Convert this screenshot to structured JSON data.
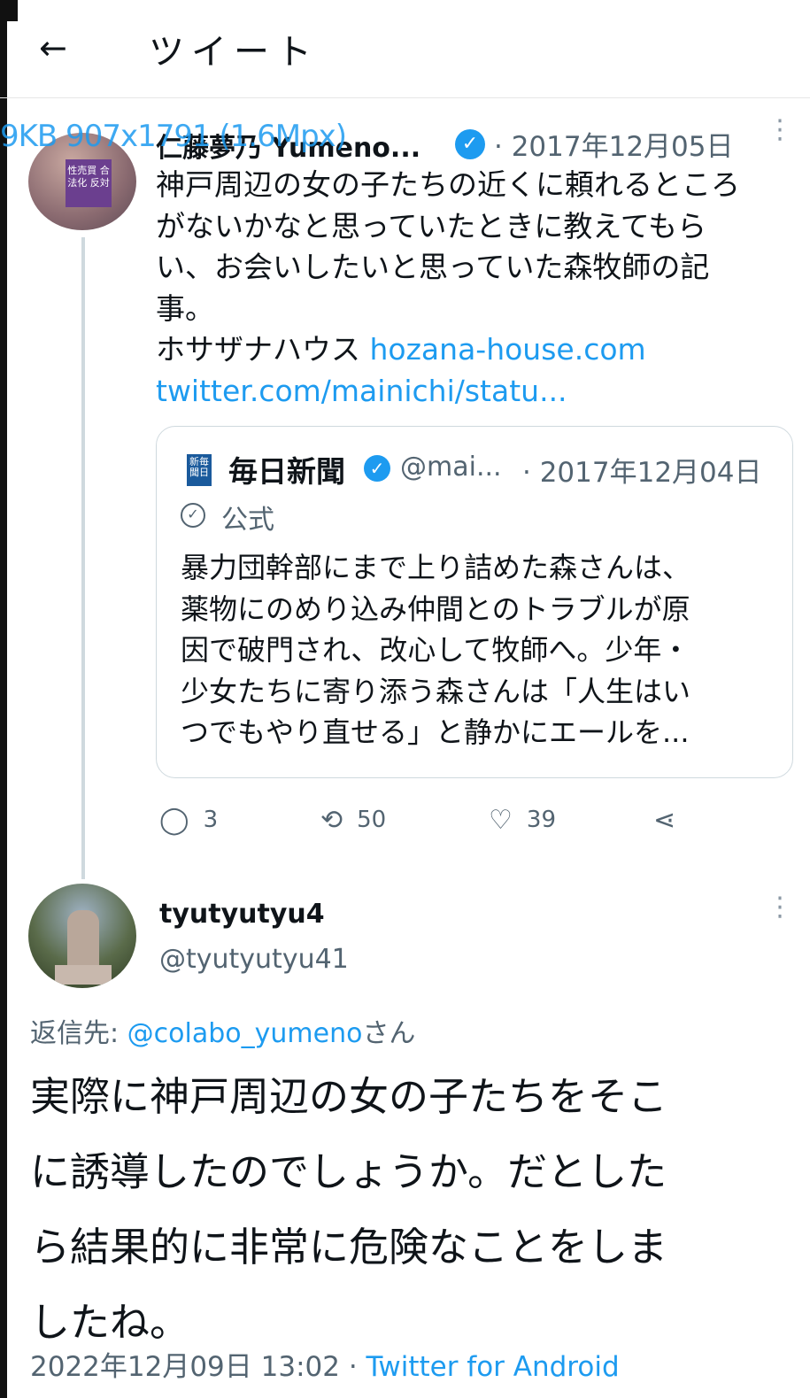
{
  "header": {
    "back_glyph": "←",
    "title": "ツイート"
  },
  "overlay_meta": "9KB 907x1791 (1.6Mpx)",
  "tweet": {
    "author": "仁藤夢乃 Yumeno...",
    "verified_glyph": "✓",
    "date": "· 2017年12月05日",
    "more_glyph": "⋮",
    "avatar_sign": "性売買 合法化 反対",
    "text_lines": [
      "神戸周辺の女の子たちの近くに頼れるところ",
      "がないかなと思っていたときに教えてもら",
      "い、お会いしたいと思っていた森牧師の記",
      "事。"
    ],
    "line5_prefix": "ホサザナハウス",
    "link1": "hozana-house.com",
    "link2": "twitter.com/mainichi/statu...",
    "quote": {
      "logo_text": "新毎 聞日",
      "name": "毎日新聞",
      "verified_glyph": "✓",
      "handle": "@mai...",
      "date": "· 2017年12月04日",
      "official_glyph": "✓",
      "official_label": "公式",
      "text_lines": [
        "暴力団幹部にまで上り詰めた森さんは、",
        "薬物にのめり込み仲間とのトラブルが原",
        "因で破門され、改心して牧師へ。少年・",
        "少女たちに寄り添う森さんは「人生はい",
        "つでもやり直せる」と静かにエールを..."
      ]
    },
    "actions": {
      "reply_icon": "comment-icon",
      "reply_glyph": "◯",
      "reply_count": "3",
      "retweet_icon": "retweet-icon",
      "retweet_glyph": "⟲",
      "retweet_count": "50",
      "like_icon": "heart-icon",
      "like_glyph": "♡",
      "like_count": "39",
      "share_icon": "share-icon",
      "share_glyph": "⋖"
    }
  },
  "reply": {
    "author": "tyutyutyu4",
    "handle": "@tyutyutyu41",
    "more_glyph": "⋮",
    "reply_to_label": "返信先: ",
    "reply_to_mention": "@colabo_yumeno",
    "reply_to_suffix": "さん",
    "text_lines": [
      "実際に神戸周辺の女の子たちをそこ",
      "に誘導したのでしょうか。だとした",
      "ら結果的に非常に危険なことをしま",
      "したね。"
    ],
    "timestamp": "2022年12月09日 13:02 · ",
    "source": "Twitter for Android"
  }
}
